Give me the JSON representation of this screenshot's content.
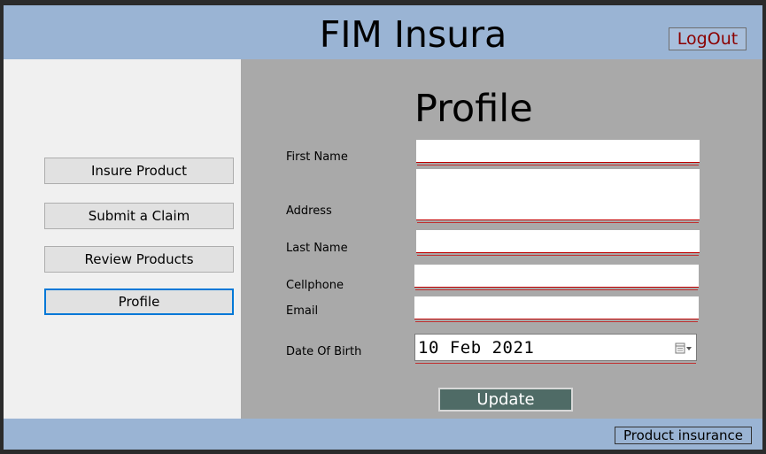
{
  "header": {
    "app_title": "FIM Insura",
    "logout_label": "LogOut"
  },
  "sidebar": {
    "items": [
      {
        "label": "Insure Product"
      },
      {
        "label": "Submit a Claim"
      },
      {
        "label": "Review Products"
      },
      {
        "label": "Profile",
        "active": true
      }
    ]
  },
  "main": {
    "page_title": "Profile",
    "fields": {
      "first_name": {
        "label": "First Name",
        "value": ""
      },
      "address": {
        "label": "Address",
        "value": ""
      },
      "last_name": {
        "label": "Last Name",
        "value": ""
      },
      "cellphone": {
        "label": "Cellphone",
        "value": ""
      },
      "email": {
        "label": "Email",
        "value": ""
      },
      "date_of_birth": {
        "label": "Date Of Birth",
        "value": "10 Feb 2021"
      }
    },
    "update_label": "Update"
  },
  "footer": {
    "label": "Product insurance"
  },
  "colors": {
    "header_bg": "#9ab4d4",
    "sidebar_bg": "#f0f0f0",
    "main_bg": "#a9a9a9",
    "logout_text": "#8b0000",
    "update_bg": "#4f6b66",
    "active_border": "#0078d7",
    "validation_line": "#c00000"
  },
  "icons": {
    "date_picker": "calendar-icon"
  }
}
